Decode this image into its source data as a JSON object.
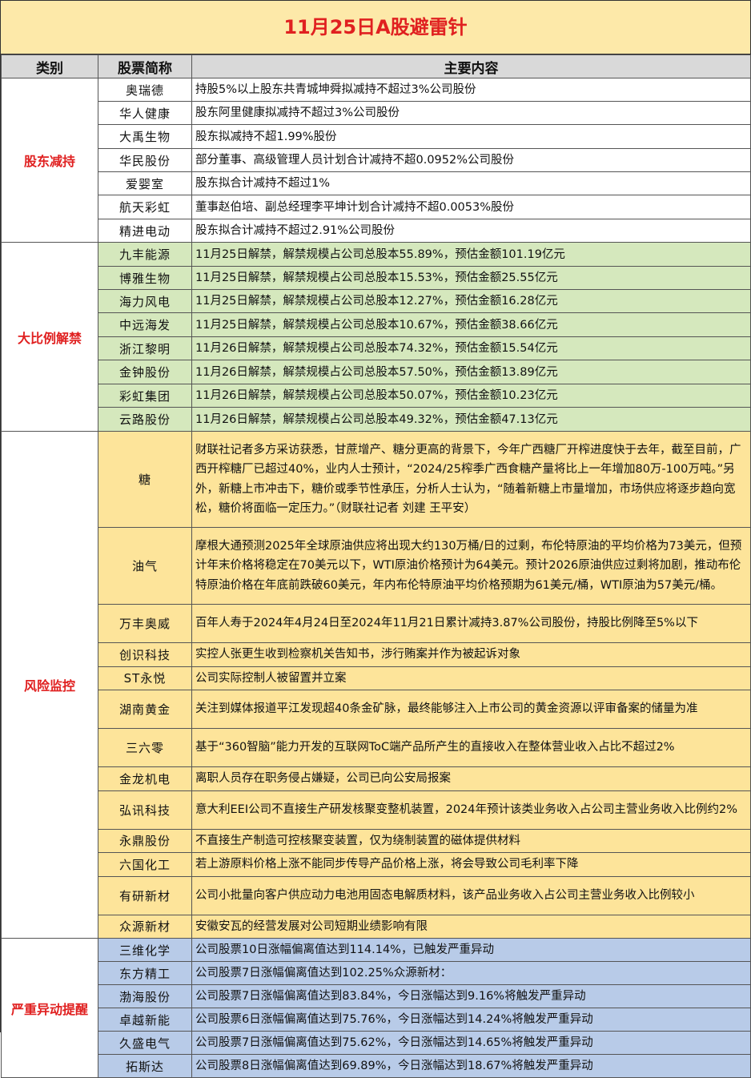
{
  "title": "11月25日A股避雷针",
  "headers": {
    "category": "类别",
    "stock": "股票简称",
    "content": "主要内容"
  },
  "sections": {
    "holders": {
      "category": "股东减持",
      "rows": [
        {
          "name": "奥瑞德",
          "content": "持股5%以上股东共青城坤舜拟减持不超过3%公司股份"
        },
        {
          "name": "华人健康",
          "content": "股东阿里健康拟减持不超过3%公司股份"
        },
        {
          "name": "大禹生物",
          "content": "股东拟减持不超1.99%股份"
        },
        {
          "name": "华民股份",
          "content": "部分董事、高级管理人员计划合计减持不超0.0952%公司股份"
        },
        {
          "name": "爱婴室",
          "content": "股东拟合计减持不超过1%"
        },
        {
          "name": "航天彩虹",
          "content": "董事赵伯培、副总经理李平坤计划合计减持不超0.0053%股份"
        },
        {
          "name": "精进电动",
          "content": "股东拟合计减持不超过2.91%公司股份"
        }
      ]
    },
    "unlock": {
      "category": "大比例解禁",
      "rows": [
        {
          "name": "九丰能源",
          "content": "11月25日解禁，解禁规模占公司总股本55.89%，预估金额101.19亿元"
        },
        {
          "name": "博雅生物",
          "content": "11月25日解禁，解禁规模占公司总股本15.53%，预估金额25.55亿元"
        },
        {
          "name": "海力风电",
          "content": "11月25日解禁，解禁规模占公司总股本12.27%，预估金额16.28亿元"
        },
        {
          "name": "中远海发",
          "content": "11月25日解禁，解禁规模占公司总股本10.67%，预估金额38.66亿元"
        },
        {
          "name": "浙江黎明",
          "content": "11月26日解禁，解禁规模占公司总股本74.32%，预估金额15.54亿元"
        },
        {
          "name": "金钟股份",
          "content": "11月26日解禁，解禁规模占公司总股本57.50%，预估金额13.89亿元"
        },
        {
          "name": "彩虹集团",
          "content": "11月26日解禁，解禁规模占公司总股本50.07%，预估金额10.23亿元"
        },
        {
          "name": "云路股份",
          "content": "11月26日解禁，解禁规模占公司总股本49.32%，预估金额47.13亿元"
        }
      ]
    },
    "risk": {
      "category": "风险监控",
      "rows": [
        {
          "name": "糖",
          "content": "财联社记者多方采访获悉，甘蔗增产、糖分更高的背景下，今年广西糖厂开榨进度快于去年，截至目前，广西开榨糖厂已超过40%，业内人士预计，“2024/25榨季广西食糖产量将比上一年增加80万-100万吨。”另外，新糖上市冲击下，糖价或季节性承压，分析人士认为，“随着新糖上市量增加，市场供应将逐步趋向宽松，糖价将面临一定压力。”（财联社记者 刘建 王平安）"
        },
        {
          "name": "油气",
          "content": "摩根大通预测2025年全球原油供应将出现大约130万桶/日的过剩，布伦特原油的平均价格为73美元，但预计年末价格将稳定在70美元以下，WTI原油价格预计为64美元。预计2026原油供应过剩将加剧，推动布伦特原油价格在年底前跌破60美元，年内布伦特原油平均价格预期为61美元/桶，WTI原油为57美元/桶。"
        },
        {
          "name": "万丰奥威",
          "content": "百年人寿于2024年4月24日至2024年11月21日累计减持3.87%公司股份，持股比例降至5%以下"
        },
        {
          "name": "创识科技",
          "content": "实控人张更生收到检察机关告知书，涉行贿案并作为被起诉对象"
        },
        {
          "name": "ST永悦",
          "content": "公司实际控制人被留置并立案"
        },
        {
          "name": "湖南黄金",
          "content": "关注到媒体报道平江发现超40条金矿脉，最终能够注入上市公司的黄金资源以评审备案的储量为准"
        },
        {
          "name": "三六零",
          "content": "基于“360智脑”能力开发的互联网ToC端产品所产生的直接收入在整体营业收入占比不超过2%"
        },
        {
          "name": "金龙机电",
          "content": "离职人员存在职务侵占嫌疑，公司已向公安局报案"
        },
        {
          "name": "弘讯科技",
          "content": "意大利EEI公司不直接生产研发核聚变整机装置，2024年预计该类业务收入占公司主营业务收入比例约2%"
        },
        {
          "name": "永鼎股份",
          "content": "不直接生产制造可控核聚变装置，仅为绕制装置的磁体提供材料"
        },
        {
          "name": "六国化工",
          "content": "若上游原料价格上涨不能同步传导产品价格上涨，将会导致公司毛利率下降"
        },
        {
          "name": "有研新材",
          "content": "公司小批量向客户供应动力电池用固态电解质材料，该产品业务收入占公司主营业务收入比例较小"
        },
        {
          "name": "众源新材",
          "content": "安徽安瓦的经营发展对公司短期业绩影响有限"
        }
      ]
    },
    "abnormal": {
      "category": "严重异动提醒",
      "rows": [
        {
          "name": "三维化学",
          "content": "公司股票10日涨幅偏离值达到114.14%，已触发严重异动"
        },
        {
          "name": "东方精工",
          "content": "公司股票7日涨幅偏离值达到102.25%众源新材："
        },
        {
          "name": "渤海股份",
          "content": "公司股票7日涨幅偏离值达到83.84%，今日涨幅达到9.16%将触发严重异动"
        },
        {
          "name": "卓越新能",
          "content": "公司股票6日涨幅偏离值达到75.76%，今日涨幅达到14.24%将触发严重异动"
        },
        {
          "name": "久盛电气",
          "content": "公司股票7日涨幅偏离值达到75.62%，今日涨幅达到14.65%将触发严重异动"
        },
        {
          "name": "拓斯达",
          "content": "公司股票8日涨幅偏离值达到69.89%，今日涨幅达到18.67%将触发严重异动"
        }
      ]
    }
  },
  "colors": {
    "title_bg": "#fde9a9",
    "title_text": "#e02020",
    "header_bg": "#d9d9d9",
    "green": "#d5e8bd",
    "yellow": "#fde49a",
    "blue": "#b8cbe8"
  }
}
